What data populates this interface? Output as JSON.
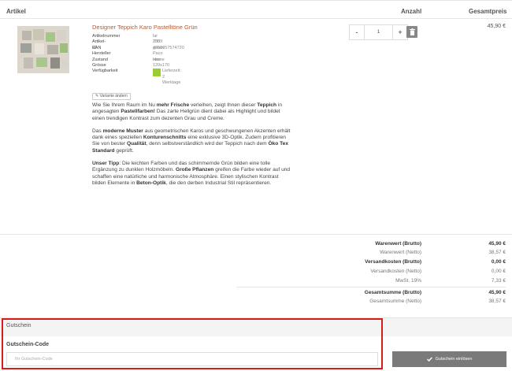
{
  "columns": {
    "artikel": "Artikel",
    "anzahl": "Anzahl",
    "gesamtpreis": "Gesamtpreis"
  },
  "product": {
    "title": "Designer Teppich Karo Pastelltöne Grün",
    "attributes": [
      {
        "label": "Artikelnummer",
        "value": "lar 235 green"
      },
      {
        "label": "Artikel-ID",
        "value": "7009"
      },
      {
        "label": "EAN",
        "value": "4250057574720"
      },
      {
        "label": "Hersteller",
        "value": "Paco Home"
      },
      {
        "label": "Zustand",
        "value": "neu"
      },
      {
        "label": "Grösse",
        "value": "120x170 cm"
      }
    ],
    "availability_label": "Verfügbarkeit",
    "availability_value": "Lieferzeit: 2 Werktage",
    "availability_color": "#9acd32",
    "variant_button": "Variante ändern",
    "description": {
      "p1": {
        "t1": "Wie Sie Ihrem Raum im Nu ",
        "b1": "mehr Frische",
        "t2": " verleihen, zeigt Ihnen dieser ",
        "b2": "Teppich",
        "t3": " in angesagten ",
        "b3": "Pastellfarben!",
        "t4": " Das zarte Hellgrün dient dabei als Highlight und bildet einen trendigen Kontrast zum dezenten Grau und Creme."
      },
      "p2": {
        "t1": "Das ",
        "b1": "moderne Muster",
        "t2": " aus geometrischen Karos und geschwungenen Akzenten erhält dank eines speziellen ",
        "b2": "Konturenschnitts",
        "t3": " eine exklusive 3D-Optik. Zudem profitieren Sie von bester ",
        "b3": "Qualität",
        "t4": ", denn selbstverständlich wird der Teppich nach dem ",
        "b4": "Öko Tex Standard",
        "t5": " geprüft."
      },
      "p3": {
        "b1": "Unser Tipp",
        "t1": ": Die leichten Farben und das schimmernde Grün bilden eine tolle Ergänzung zu dunklen Holzmöbeln. ",
        "b2": "Große Pflanzen",
        "t2": " greifen die Farbe wieder auf und schaffen eine natürliche und harmonische Atmosphäre. Einen stylischen Kontrast bilden Elemente in ",
        "b3": "Beton-Optik",
        "t3": ", die den derben Industrial Stil repräsentieren."
      }
    },
    "quantity": "1",
    "minus": "-",
    "plus": "+",
    "price": "45,90 €"
  },
  "summary": [
    {
      "label": "Warenwert (Brutto)",
      "value": "45,90 €",
      "bold": true
    },
    {
      "label": "Warenwert (Netto)",
      "value": "38,57 €",
      "bold": false
    },
    {
      "label": "Versandkosten (Brutto)",
      "value": "0,00 €",
      "bold": true
    },
    {
      "label": "Versandkosten (Netto)",
      "value": "0,00 €",
      "bold": false
    },
    {
      "label": "MwSt. 19%",
      "value": "7,33 €",
      "bold": false
    }
  ],
  "totals": [
    {
      "label": "Gesamtsumme (Brutto)",
      "value": "45,90 €",
      "bold": true
    },
    {
      "label": "Gesamtsumme (Netto)",
      "value": "38,57 €",
      "bold": false
    }
  ],
  "coupon": {
    "section_title": "Gutschein",
    "code_label": "Gutschein-Code",
    "placeholder": "Ihr Gutschein-Code",
    "button": "Gutschein einlösen"
  },
  "colors": {
    "title_accent": "#b55a30",
    "highlight_box": "#d71c1c",
    "button_bg": "#7a7a7a"
  }
}
